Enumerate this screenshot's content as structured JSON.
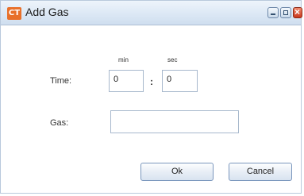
{
  "window": {
    "app_icon_text": "CT",
    "title": "Add Gas"
  },
  "form": {
    "min_label": "min",
    "sec_label": "sec",
    "time_label": "Time:",
    "minutes_value": "0",
    "separator": ":",
    "seconds_value": "0",
    "gas_label": "Gas:",
    "gas_value": ""
  },
  "buttons": {
    "ok_label": "Ok",
    "cancel_label": "Cancel"
  },
  "colors": {
    "title_bar": "#dce8f5",
    "app_icon": "#e8702a",
    "close_button": "#c9361c"
  }
}
